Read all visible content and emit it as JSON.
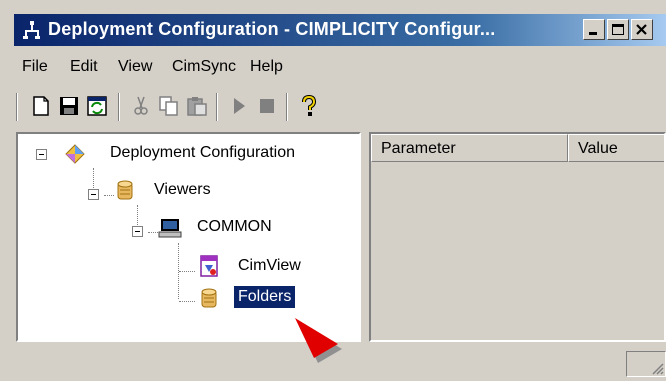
{
  "window": {
    "title": "Deployment Configuration - CIMPLICITY Configur...",
    "controls": [
      "minimize",
      "maximize",
      "close"
    ]
  },
  "menu": {
    "items": [
      "File",
      "Edit",
      "View",
      "CimSync",
      "Help"
    ]
  },
  "toolbar": {
    "buttons": [
      "new-icon",
      "save-icon",
      "refresh-icon",
      "cut-icon",
      "copy-icon",
      "paste-icon",
      "run-icon",
      "stop-icon",
      "help-icon"
    ]
  },
  "tree": {
    "root": "Deployment Configuration",
    "viewers": "Viewers",
    "common": "COMMON",
    "cimview": "CimView",
    "folders": "Folders",
    "selected": "Folders"
  },
  "list": {
    "columns": [
      "Parameter",
      "Value"
    ]
  },
  "colors": {
    "title_bar": "#0a246a",
    "selection": "#0a246a",
    "face": "#d4d0c8",
    "cursor": "#e00000"
  }
}
